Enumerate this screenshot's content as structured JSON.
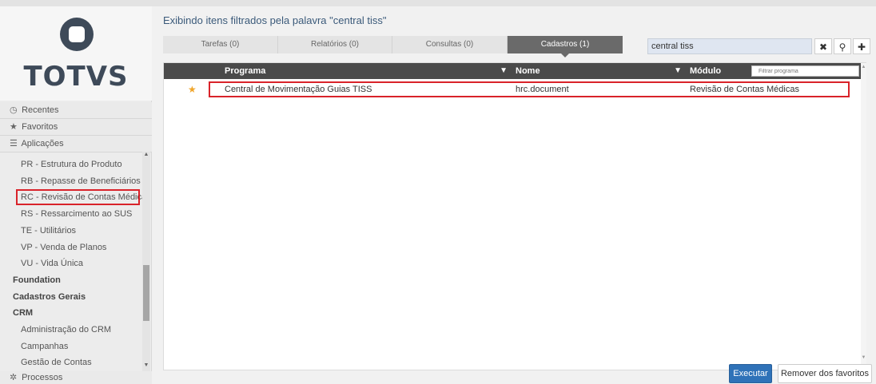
{
  "logo": {
    "text": "TOTVS"
  },
  "sidebar": {
    "recentes": "Recentes",
    "favoritos": "Favoritos",
    "aplicacoes": "Aplicações",
    "processos": "Processos",
    "items": [
      "PR - Estrutura do Produto",
      "RB - Repasse de Beneficiários",
      "RC - Revisão de Contas Médicas",
      "RS - Ressarcimento ao SUS",
      "TE - Utilitários",
      "VP - Venda de Planos",
      "VU - Vida Única",
      "Foundation",
      "Cadastros Gerais",
      "CRM",
      "Administração do CRM",
      "Campanhas",
      "Gestão de Contas"
    ]
  },
  "main": {
    "heading": "Exibindo itens filtrados pela palavra \"central tiss\"",
    "tabs": [
      "Tarefas (0)",
      "Relatórios (0)",
      "Consultas (0)",
      "Cadastros (1)"
    ],
    "search_value": "central tiss",
    "columns": {
      "programa": "Programa",
      "nome": "Nome",
      "modulo": "Módulo"
    },
    "filter_placeholder": "Filtrar programa",
    "rows": [
      {
        "programa": "Central de Movimentação Guias TISS",
        "nome": "hrc.document",
        "modulo": "Revisão de Contas Médicas"
      }
    ],
    "btn_executar": "Executar",
    "btn_remover": "Remover dos favoritos"
  },
  "colors": {
    "accent": "#2f72b8",
    "highlight": "#d9232a",
    "star": "#f0a52a",
    "header": "#4a4a4a"
  }
}
